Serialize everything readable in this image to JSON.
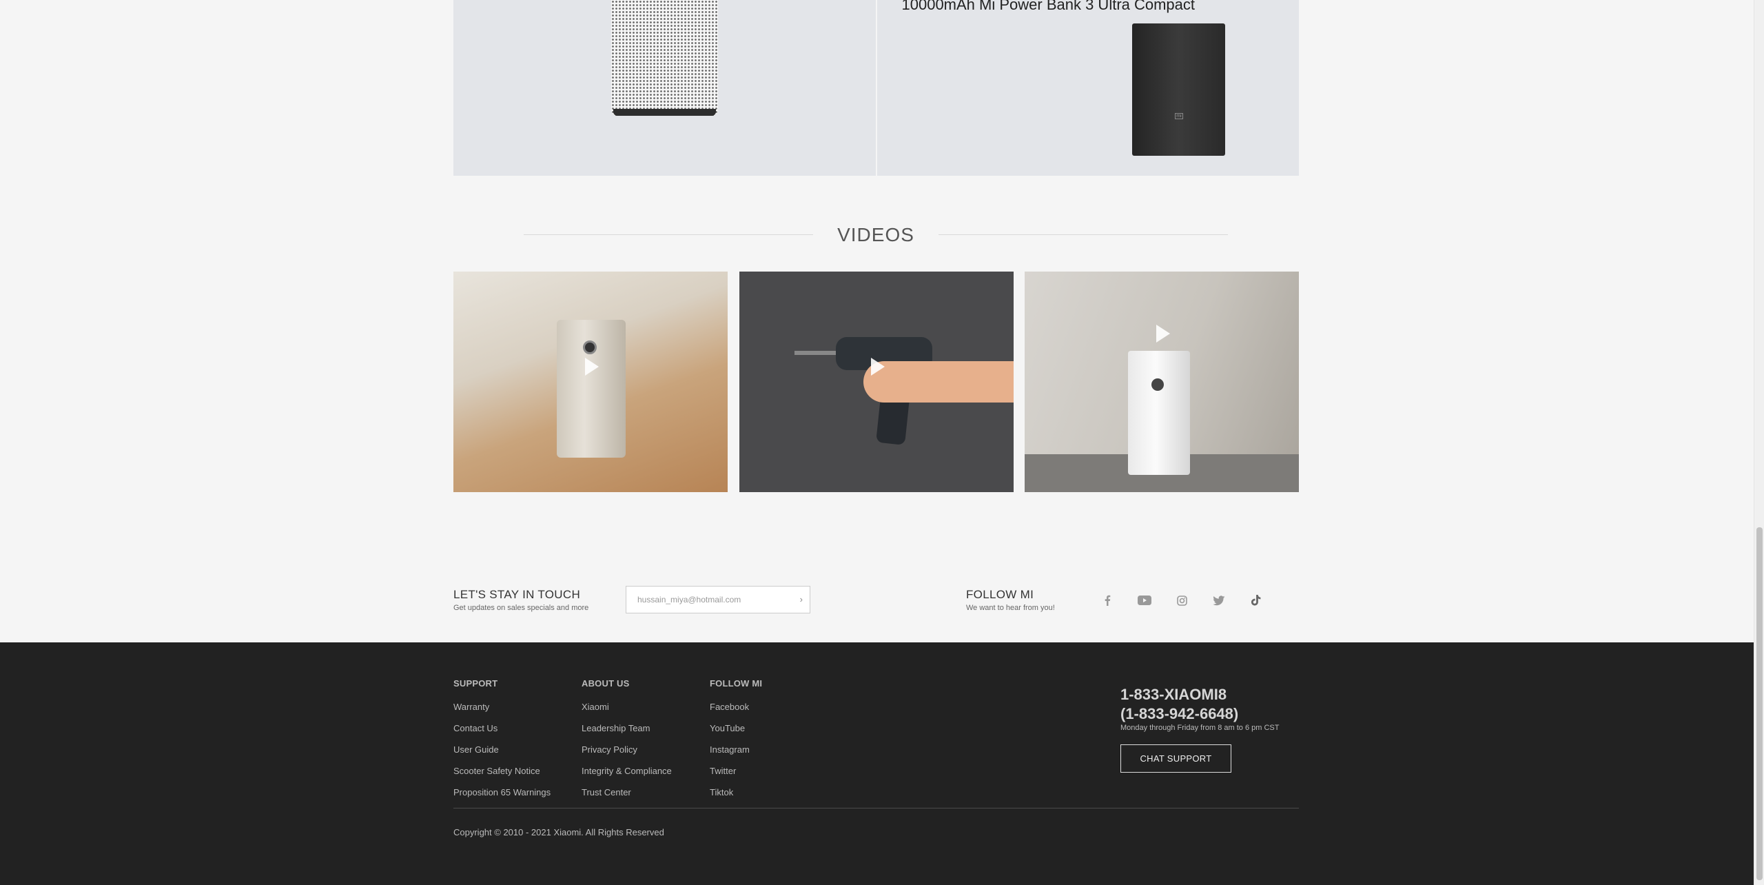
{
  "products": {
    "card2_title": "10000mAh Mi Power Bank 3 Ultra Compact"
  },
  "videos": {
    "title": "VIDEOS",
    "items": [
      {
        "name": "air-purifier-video-1"
      },
      {
        "name": "drill-video"
      },
      {
        "name": "air-purifier-video-2"
      }
    ]
  },
  "newsletter": {
    "title": "LET'S STAY IN TOUCH",
    "subtitle": "Get updates on sales specials and more",
    "email_value": "hussain_miya@hotmail.com",
    "submit_icon": "chevron-right-icon"
  },
  "follow": {
    "title": "FOLLOW MI",
    "subtitle": "We want to hear from you!",
    "icons": [
      "facebook-icon",
      "youtube-icon",
      "instagram-icon",
      "twitter-icon",
      "tiktok-icon"
    ]
  },
  "footer": {
    "support": {
      "heading": "SUPPORT",
      "links": [
        "Warranty",
        "Contact Us",
        "User Guide",
        "Scooter Safety Notice",
        "Proposition 65 Warnings"
      ]
    },
    "about": {
      "heading": "ABOUT US",
      "links": [
        "Xiaomi",
        "Leadership Team",
        "Privacy Policy",
        "Integrity & Compliance",
        "Trust Center"
      ]
    },
    "follow": {
      "heading": "FOLLOW MI",
      "links": [
        "Facebook",
        "YouTube",
        "Instagram",
        "Twitter",
        "Tiktok"
      ]
    },
    "phone_line1": "1-833-XIAOMI8",
    "phone_line2": "(1-833-942-6648)",
    "hours": "Monday through Friday from 8 am to 6 pm CST",
    "chat_label": "CHAT SUPPORT",
    "copyright": "Copyright © 2010 - 2021 Xiaomi. All Rights Reserved"
  }
}
